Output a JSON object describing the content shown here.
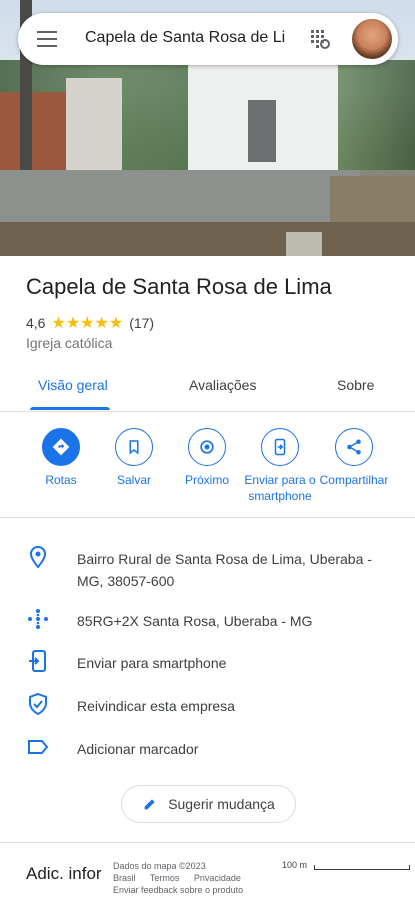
{
  "search": {
    "query": "Capela de Santa Rosa de Lin"
  },
  "place": {
    "title": "Capela de Santa Rosa de Lima",
    "rating": "4,6",
    "stars": "★★★★★",
    "review_count": "(17)",
    "category": "Igreja católica"
  },
  "tabs": [
    {
      "label": "Visão geral"
    },
    {
      "label": "Avaliações"
    },
    {
      "label": "Sobre"
    }
  ],
  "actions": [
    {
      "label": "Rotas",
      "icon": "directions-icon"
    },
    {
      "label": "Salvar",
      "icon": "bookmark-icon"
    },
    {
      "label": "Próximo",
      "icon": "nearby-icon"
    },
    {
      "label": "Enviar para o smartphone",
      "icon": "send-to-phone-icon"
    },
    {
      "label": "Compartilhar",
      "icon": "share-icon"
    }
  ],
  "info": {
    "address": "Bairro Rural de Santa Rosa de Lima, Uberaba - MG, 38057-600",
    "plus_code": "85RG+2X Santa Rosa, Uberaba - MG",
    "send_phone": "Enviar para smartphone",
    "claim": "Reivindicar esta empresa",
    "label": "Adicionar marcador"
  },
  "suggest_label": "Sugerir mudança",
  "more_info": "Adic. infor",
  "map_attribution": {
    "data": "Dados do mapa ©2023",
    "brasil": "Brasil",
    "terms": "Termos",
    "privacy": "Privacidade",
    "feedback": "Enviar feedback sobre o produto",
    "scale": "100 m"
  },
  "colors": {
    "accent": "#1a73e8",
    "star": "#fbbc04"
  }
}
